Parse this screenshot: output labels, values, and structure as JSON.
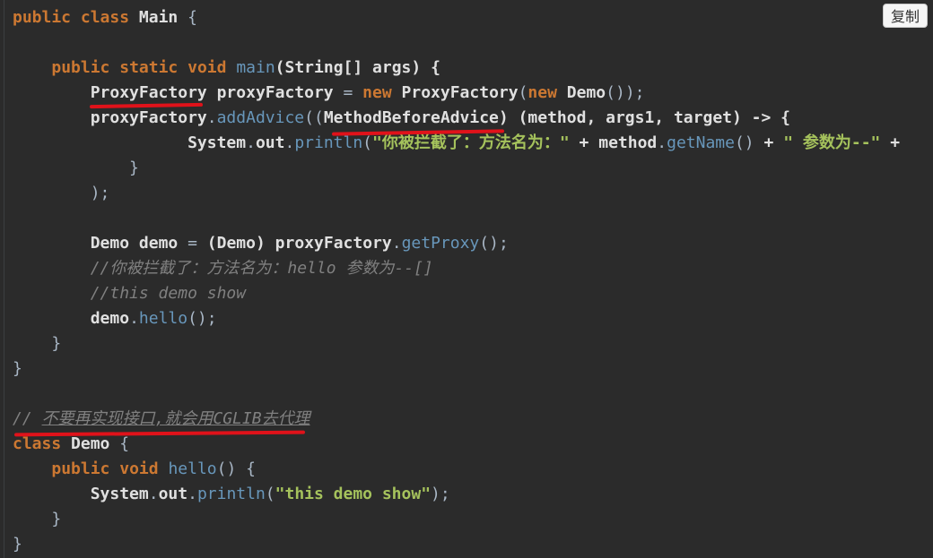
{
  "toolbar": {
    "copy_label": "复制"
  },
  "code": {
    "l1": {
      "kw_public": "public",
      "kw_class": "class",
      "name": "Main",
      "brace": "{"
    },
    "l3": {
      "kw_public": "public",
      "kw_static": "static",
      "kw_void": "void",
      "fn": "main",
      "params": "(String[] args) {"
    },
    "l4": {
      "type": "ProxyFactory",
      "var": "proxyFactory",
      "eq": "=",
      "kw_new": "new",
      "ctor": "ProxyFactory",
      "paren": "(",
      "kw_new2": "new",
      "demo": "Demo",
      "end": "());"
    },
    "l5": {
      "obj": "proxyFactory",
      "dot": ".",
      "fn": "addAdvice",
      "open": "((",
      "cast": "MethodBeforeAdvice",
      "rest": ") (method, args1, target) -> {"
    },
    "l6": {
      "sys": "System",
      "dot1": ".",
      "out": "out",
      "dot2": ".",
      "fn": "println",
      "open": "(",
      "str1": "\"你被拦截了：方法名为：\"",
      "plus1": "+",
      "method": "method",
      "dot3": ".",
      "getname": "getName",
      "call": "()",
      "plus2": "+",
      "str2": "\" 参数为--\"",
      "trail": "+"
    },
    "l7": {
      "brace": "}"
    },
    "l8": {
      "end": ");"
    },
    "l10": {
      "type": "Demo",
      "var": "demo",
      "eq": "=",
      "cast": "(Demo)",
      "obj": "proxyFactory",
      "dot": ".",
      "fn": "getProxy",
      "end": "();"
    },
    "l11": {
      "comment": "//你被拦截了：方法名为：hello 参数为--[]"
    },
    "l12": {
      "comment": "//this demo show"
    },
    "l13": {
      "obj": "demo",
      "dot": ".",
      "fn": "hello",
      "end": "();"
    },
    "l14": {
      "brace": "}"
    },
    "l15": {
      "brace": "}"
    },
    "l17": {
      "slashes": "//",
      "comment": "不要再实现接口,就会用CGLIB去代理"
    },
    "l18": {
      "kw_class": "class",
      "name": "Demo",
      "brace": "{"
    },
    "l19": {
      "kw_public": "public",
      "kw_void": "void",
      "fn": "hello",
      "end": "() {"
    },
    "l20": {
      "sys": "System",
      "dot1": ".",
      "out": "out",
      "dot2": ".",
      "fn": "println",
      "open": "(",
      "str": "\"this demo show\"",
      "end": ");"
    },
    "l21": {
      "brace": "}"
    },
    "l22": {
      "brace": "}"
    }
  },
  "colors": {
    "background": "#2b2b2b",
    "keyword": "#cc7832",
    "function": "#6897bb",
    "string": "#a5c25c",
    "comment": "#808080",
    "annotation_underline": "#e0121a"
  }
}
